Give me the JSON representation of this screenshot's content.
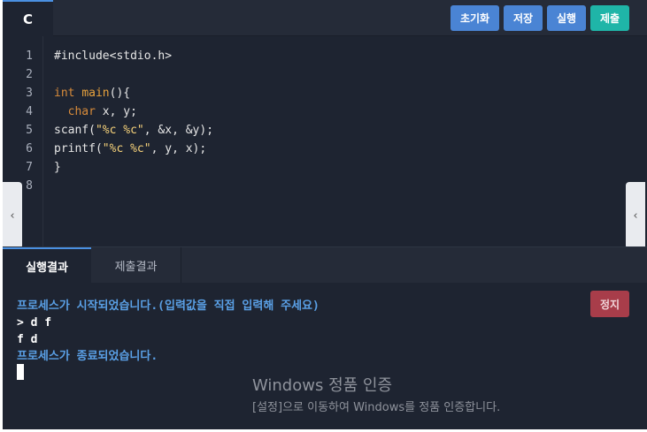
{
  "toolbar": {
    "language_tab": "C",
    "buttons": [
      {
        "label": "초기화"
      },
      {
        "label": "저장"
      },
      {
        "label": "실행"
      },
      {
        "label": "제출"
      }
    ],
    "colors": {
      "primary": "#4a84d4",
      "submit": "#1fb5a8"
    }
  },
  "editor": {
    "line_numbers": [
      "1",
      "2",
      "3",
      "4",
      "5",
      "6",
      "7",
      "8"
    ],
    "lines": [
      {
        "parts": [
          {
            "t": "#include<stdio.h>",
            "c": ""
          }
        ]
      },
      {
        "parts": []
      },
      {
        "parts": [
          {
            "t": "int",
            "c": "kw"
          },
          {
            "t": " ",
            "c": ""
          },
          {
            "t": "main",
            "c": "fn"
          },
          {
            "t": "(){",
            "c": ""
          }
        ]
      },
      {
        "parts": [
          {
            "t": "  ",
            "c": ""
          },
          {
            "t": "char",
            "c": "kw"
          },
          {
            "t": " x, y;",
            "c": ""
          }
        ]
      },
      {
        "parts": [
          {
            "t": "scanf(",
            "c": ""
          },
          {
            "t": "\"%c %c\"",
            "c": "str"
          },
          {
            "t": ", &x, &y);",
            "c": ""
          }
        ]
      },
      {
        "parts": [
          {
            "t": "printf(",
            "c": ""
          },
          {
            "t": "\"%c %c\"",
            "c": "str"
          },
          {
            "t": ", y, x);",
            "c": ""
          }
        ]
      },
      {
        "parts": [
          {
            "t": "}",
            "c": ""
          }
        ]
      },
      {
        "parts": []
      }
    ],
    "left_arrow": "‹",
    "right_arrow": "‹"
  },
  "result_tabs": [
    {
      "label": "실행결과",
      "active": true
    },
    {
      "label": "제출결과",
      "active": false
    }
  ],
  "console": {
    "lines": [
      {
        "text": "프로세스가 시작되었습니다.(입력값을 직접 입력해 주세요)",
        "kind": "sys"
      },
      {
        "text": "> d f",
        "kind": "usr"
      },
      {
        "text": "f d",
        "kind": "usr"
      },
      {
        "text": "프로세스가 종료되었습니다.",
        "kind": "sys"
      }
    ],
    "stop_label": "정지",
    "stop_color": "#a83d4a"
  },
  "watermark": {
    "title": "Windows 정품 인증",
    "subtitle": "[설정]으로 이동하여 Windows를 정품 인증합니다."
  }
}
